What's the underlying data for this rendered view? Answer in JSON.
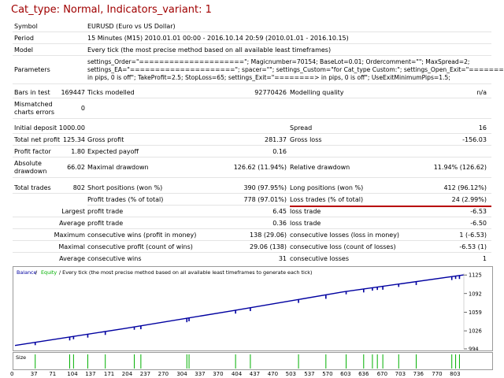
{
  "title": "Cat_type: Normal, Indicators_variant: 1",
  "report": {
    "symbol_label": "Symbol",
    "symbol_value": "EURUSD (Euro vs US Dollar)",
    "period_label": "Period",
    "period_value": "15 Minutes (M15) 2010.01.01 00:00 - 2016.10.14 20:59 (2010.01.01 - 2016.10.15)",
    "model_label": "Model",
    "model_value": "Every tick (the most precise method based on all available least timeframes)",
    "parameters_label": "Parameters",
    "parameters_line1": "settings_Order=\"=====================\"; Magicnumber=70154; BaseLot=0.01; Ordercomment=\"\"; MaxSpread=2;",
    "parameters_line2": "settings_EA=\"=====================\"; spacer=\"\"; settings_Custom=\"for Cat_type Custom:\"; settings_Open_Exit=\"========>",
    "parameters_line3": "in pips, 0 is off\"; TakeProfit=2.5; StopLoss=65; settings_Exit=\"========> in pips, 0 is off\"; UseExitMinimumPips=1.5;",
    "bars_label": "Bars in test",
    "bars_value": "169447",
    "ticks_label": "Ticks modelled",
    "ticks_value": "92770426",
    "quality_label": "Modelling quality",
    "quality_value": "n/a",
    "mismatch_label_1": "Mismatched",
    "mismatch_label_2": "charts errors",
    "mismatch_value": "0",
    "deposit_label": "Initial deposit",
    "deposit_value": "1000.00",
    "spread_label": "Spread",
    "spread_value": "16",
    "net_label": "Total net profit",
    "net_value": "125.34",
    "gross_profit_label": "Gross profit",
    "gross_profit_value": "281.37",
    "gross_loss_label": "Gross loss",
    "gross_loss_value": "-156.03",
    "pf_label": "Profit factor",
    "pf_value": "1.80",
    "payoff_label": "Expected payoff",
    "payoff_value": "0.16",
    "abs_dd_label_1": "Absolute",
    "abs_dd_label_2": "drawdown",
    "abs_dd_value": "66.02",
    "max_dd_label": "Maximal drawdown",
    "max_dd_value": "126.62 (11.94%)",
    "rel_dd_label": "Relative drawdown",
    "rel_dd_value": "11.94% (126.62)",
    "trades_label": "Total trades",
    "trades_value": "802",
    "short_label": "Short positions (won %)",
    "short_value": "390 (97.95%)",
    "long_label": "Long positions (won %)",
    "long_value": "412 (96.12%)",
    "profit_trades_label": "Profit trades (% of total)",
    "profit_trades_value": "778 (97.01%)",
    "loss_trades_label": "Loss trades (% of total)",
    "loss_trades_value": "24 (2.99%)",
    "largest_label": "Largest",
    "largest_profit_label": "profit trade",
    "largest_profit_value": "6.45",
    "largest_loss_label": "loss trade",
    "largest_loss_value": "-6.53",
    "average_label": "Average",
    "average_profit_label": "profit trade",
    "average_profit_value": "0.36",
    "average_loss_label": "loss trade",
    "average_loss_value": "-6.50",
    "maximum_label": "Maximum",
    "max_wins_label": "consecutive wins (profit in money)",
    "max_wins_value": "138 (29.06)",
    "max_losses_label": "consecutive losses (loss in money)",
    "max_losses_value": "1 (-6.53)",
    "maximal_label": "Maximal",
    "maximal_profit_label": "consecutive profit (count of wins)",
    "maximal_profit_value": "29.06 (138)",
    "maximal_loss_label": "consecutive loss (count of losses)",
    "maximal_loss_value": "-6.53 (1)",
    "average2_label": "Average",
    "avg_wins_label": "consecutive wins",
    "avg_wins_value": "31",
    "avg_losses_label": "consecutive losses",
    "avg_losses_value": "1"
  },
  "chart_data": {
    "type": "line",
    "legend_balance": "Balance",
    "legend_sep": " / ",
    "legend_equity": "Equity",
    "legend_rest": " / Every tick (the most precise method based on all available least timeframes to generate each tick)",
    "colors": {
      "balance": "#0000a0",
      "equity": "#00b000",
      "size": "#00b000"
    },
    "y_ticks": [
      1125,
      1092,
      1059,
      1026,
      994
    ],
    "ylim": [
      994,
      1128
    ],
    "xlim": [
      0,
      820
    ],
    "balance_points": [
      [
        0,
        1000
      ],
      [
        200,
        1030
      ],
      [
        400,
        1062
      ],
      [
        600,
        1095
      ],
      [
        820,
        1125
      ]
    ],
    "equity_dips": [
      [
        37,
        5
      ],
      [
        100,
        6
      ],
      [
        107,
        5
      ],
      [
        133,
        6
      ],
      [
        165,
        6
      ],
      [
        218,
        5
      ],
      [
        230,
        6
      ],
      [
        314,
        7
      ],
      [
        318,
        6
      ],
      [
        403,
        6
      ],
      [
        430,
        6
      ],
      [
        518,
        6
      ],
      [
        568,
        7
      ],
      [
        605,
        5
      ],
      [
        637,
        6
      ],
      [
        653,
        5
      ],
      [
        662,
        5
      ],
      [
        672,
        6
      ],
      [
        701,
        5
      ],
      [
        733,
        6
      ],
      [
        798,
        6
      ],
      [
        805,
        5
      ],
      [
        812,
        6
      ]
    ],
    "size_label": "Size",
    "size_marks": [
      37,
      100,
      107,
      133,
      165,
      218,
      230,
      314,
      318,
      403,
      430,
      518,
      568,
      605,
      637,
      653,
      662,
      672,
      701,
      733,
      798,
      805,
      812
    ],
    "x_ticks": [
      0,
      37,
      71,
      104,
      137,
      171,
      204,
      237,
      270,
      304,
      337,
      370,
      404,
      437,
      470,
      503,
      537,
      570,
      603,
      636,
      670,
      703,
      736,
      770,
      803
    ]
  }
}
